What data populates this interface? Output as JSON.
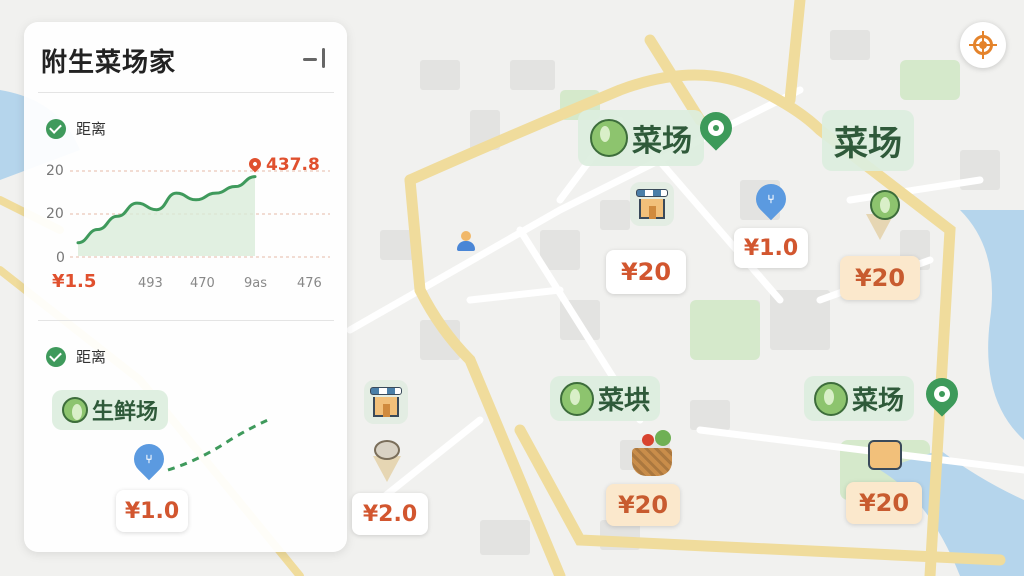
{
  "panel": {
    "title": "附生菜场家",
    "section1": {
      "label": "距离",
      "y_ticks": [
        "20",
        "20",
        "0"
      ],
      "x_ticks": [
        "¥1.5",
        "493",
        "470",
        "9as",
        "476"
      ],
      "peak_label": "437.8"
    },
    "section2": {
      "label": "距离",
      "market_tag": "生鲜场",
      "price": "¥1.0"
    }
  },
  "chart_data": {
    "type": "area",
    "title": "距离",
    "x_tick_labels": [
      "¥1.5",
      "493",
      "470",
      "9as",
      "476"
    ],
    "y_tick_labels": [
      "20",
      "20",
      "0"
    ],
    "series": [
      {
        "values": [
          4,
          8,
          12,
          16,
          14,
          19,
          17,
          19,
          21,
          24
        ]
      }
    ],
    "annotation": "437.8",
    "grid": true
  },
  "map": {
    "markers": [
      {
        "name": "菜场",
        "price": "¥20"
      },
      {
        "name": "菜场",
        "price": "¥20"
      },
      {
        "name": "菜垬",
        "price": "¥20"
      },
      {
        "name": "菜场",
        "price": "¥20"
      }
    ],
    "small_prices": [
      "¥1.0",
      "¥2.0"
    ]
  },
  "colors": {
    "accent_green": "#3d9a5a",
    "price_red": "#d2562f",
    "road_yellow": "#f3e0a4",
    "water": "#a9cde8",
    "park": "#d3e8c8"
  },
  "icons": [
    "check-icon",
    "collapse-icon",
    "locate-icon",
    "gear-icon",
    "cutlery-icon",
    "store-icon",
    "cabbage-icon",
    "user-location-icon",
    "basket-icon",
    "ice-cream-icon"
  ]
}
